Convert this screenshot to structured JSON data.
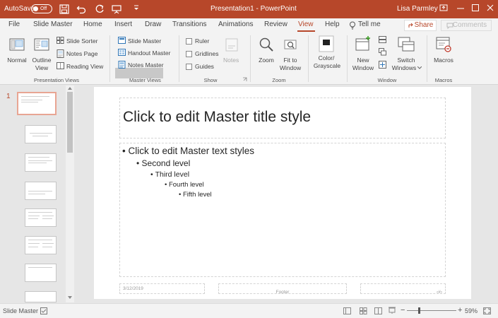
{
  "titlebar": {
    "autosave": "AutoSave",
    "toggle": "Off",
    "doc_title": "Presentation1  -  PowerPoint",
    "user": "Lisa Parmley"
  },
  "tabs": [
    "File",
    "Slide Master",
    "Home",
    "Insert",
    "Draw",
    "Transitions",
    "Animations",
    "Review",
    "View",
    "Help"
  ],
  "tell_me": "Tell me",
  "share": "Share",
  "comments": "Comments",
  "ribbon": {
    "normal": "Normal",
    "outline1": "Outline",
    "outline2": "View",
    "slide_sorter": "Slide Sorter",
    "notes_page": "Notes Page",
    "reading_view": "Reading View",
    "slide_master": "Slide Master",
    "handout_master": "Handout Master",
    "notes_master": "Notes Master",
    "ruler": "Ruler",
    "gridlines": "Gridlines",
    "guides": "Guides",
    "notes": "Notes",
    "zoom": "Zoom",
    "fit1": "Fit to",
    "fit2": "Window",
    "color1": "Color/",
    "color2": "Grayscale",
    "newwin1": "New",
    "newwin2": "Window",
    "switch1": "Switch",
    "switch2": "Windows",
    "macros": "Macros",
    "groups": {
      "presentation_views": "Presentation Views",
      "master_views": "Master Views",
      "show": "Show",
      "zoom": "Zoom",
      "window": "Window",
      "macros": "Macros"
    }
  },
  "slides_panel": {
    "selected_number": "1"
  },
  "slide": {
    "title": "Click to edit Master title style",
    "level1": "Click to edit Master text styles",
    "level2": "Second level",
    "level3": "Third level",
    "level4": "Fourth level",
    "level5": "Fifth level",
    "date": "3/12/2019",
    "footer": "Footer",
    "page": "‹#›"
  },
  "statusbar": {
    "mode": "Slide Master",
    "zoom": "59%"
  }
}
